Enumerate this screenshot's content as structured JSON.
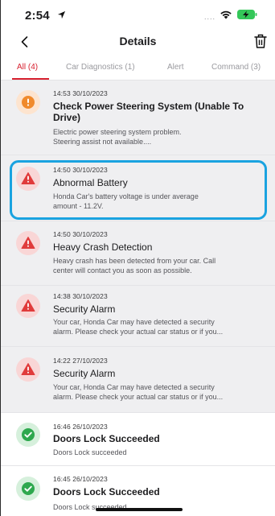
{
  "status_bar": {
    "time": "2:54",
    "signal": "....",
    "icons": [
      "location-icon",
      "wifi-icon",
      "battery-charging-icon"
    ]
  },
  "nav": {
    "title": "Details",
    "back_icon": "chevron-left-icon",
    "trash_icon": "trash-icon"
  },
  "tabs": [
    {
      "label": "All (4)",
      "active": true
    },
    {
      "label": "Car Diagnostics (1)",
      "active": false
    },
    {
      "label": "Alert",
      "active": false
    },
    {
      "label": "Command (3)",
      "active": false
    }
  ],
  "colors": {
    "accent": "#d7202f",
    "warning": "#f08a2c",
    "danger": "#e03b3b",
    "success": "#2ea84e",
    "highlight": "#1aa3e0"
  },
  "notifications": [
    {
      "icon": "warning-exclamation-icon",
      "severity": "warning",
      "time": "14:53  30/10/2023",
      "title_line1": "Check Power Steering System (Unable To",
      "title_line2": "Drive)",
      "desc_line1": "Electric power steering system problem.",
      "desc_line2": "Steering assist not available....",
      "unread": true
    },
    {
      "icon": "alert-triangle-icon",
      "severity": "danger",
      "time": "14:50  30/10/2023",
      "title_line1": "Abnormal Battery",
      "desc_line1": "Honda Car's battery voltage is under average",
      "desc_line2": "amount - 11.2V.",
      "unread": true
    },
    {
      "icon": "alert-triangle-icon",
      "severity": "danger",
      "time": "14:50  30/10/2023",
      "title_line1": "Heavy Crash Detection",
      "desc_line1": "Heavy crash has been detected from your car. Call",
      "desc_line2": "center will contact you as soon as possible.",
      "unread": true
    },
    {
      "icon": "alert-triangle-icon",
      "severity": "danger",
      "time": "14:38  30/10/2023",
      "title_line1": "Security Alarm",
      "desc_line1": "Your car, Honda Car may have detected a security",
      "desc_line2": "alarm. Please check your actual car status or if you...",
      "unread": true
    },
    {
      "icon": "alert-triangle-icon",
      "severity": "danger",
      "time": "14:22  27/10/2023",
      "title_line1": "Security Alarm",
      "desc_line1": "Your car, Honda Car may have detected a security",
      "desc_line2": "alarm. Please check your actual car status or if you...",
      "unread": true
    },
    {
      "icon": "check-circle-icon",
      "severity": "success",
      "time": "16:46  26/10/2023",
      "title_line1": "Doors Lock Succeeded",
      "desc_line1": "Doors Lock succeeded",
      "unread": false
    },
    {
      "icon": "check-circle-icon",
      "severity": "success",
      "time": "16:45  26/10/2023",
      "title_line1": "Doors Lock Succeeded",
      "desc_line1": "Doors Lock succeeded",
      "unread": false
    }
  ]
}
